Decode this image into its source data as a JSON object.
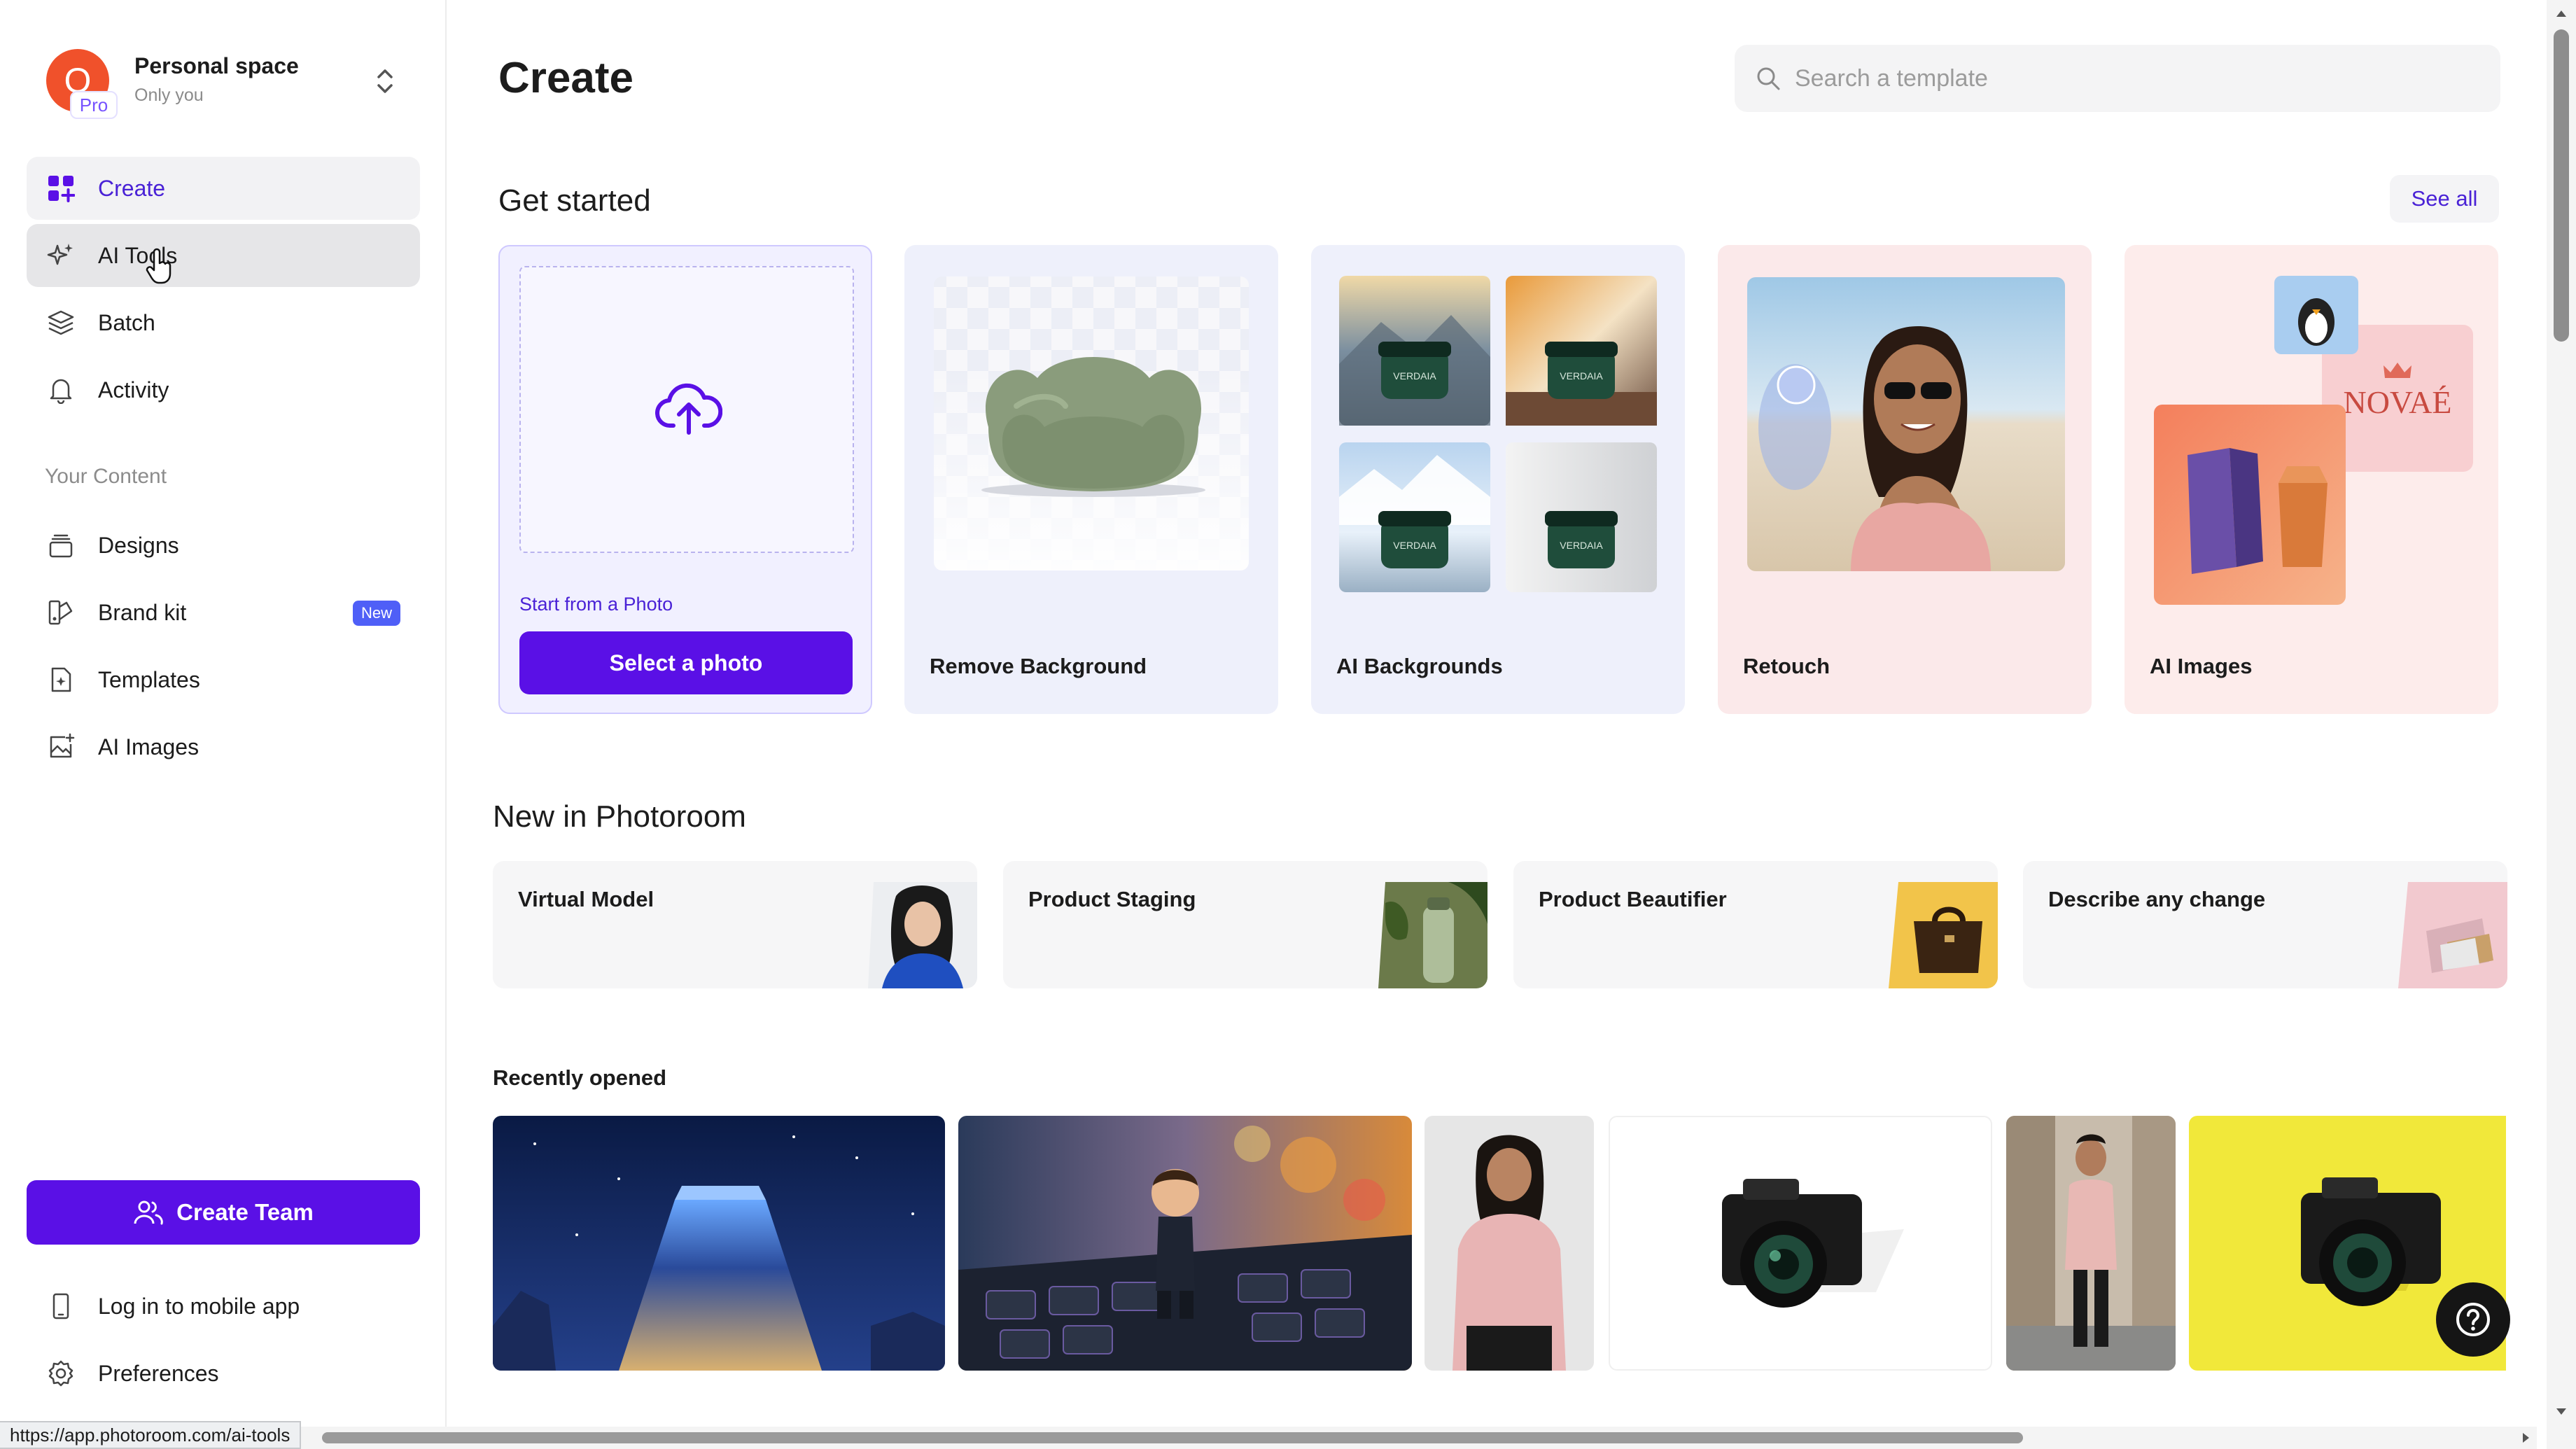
{
  "workspace": {
    "avatar_letter": "O",
    "badge": "Pro",
    "name": "Personal space",
    "subtitle": "Only you"
  },
  "nav": {
    "items": [
      {
        "label": "Create",
        "icon": "grid-icon"
      },
      {
        "label": "AI Tools",
        "icon": "sparkles-icon"
      },
      {
        "label": "Batch",
        "icon": "layers-icon"
      },
      {
        "label": "Activity",
        "icon": "bell-icon"
      }
    ],
    "section_label": "Your Content",
    "content_items": [
      {
        "label": "Designs",
        "icon": "stack-icon"
      },
      {
        "label": "Brand kit",
        "icon": "brand-icon",
        "badge": "New"
      },
      {
        "label": "Templates",
        "icon": "template-icon"
      },
      {
        "label": "AI Images",
        "icon": "image-plus-icon"
      }
    ],
    "create_team": "Create Team",
    "footer": [
      {
        "label": "Log in to mobile app",
        "icon": "phone-icon"
      },
      {
        "label": "Preferences",
        "icon": "gear-icon"
      }
    ]
  },
  "header": {
    "title": "Create",
    "search_placeholder": "Search a template"
  },
  "get_started": {
    "title": "Get started",
    "see_all": "See all",
    "upload": {
      "caption": "Start from a Photo",
      "button": "Select a photo"
    },
    "cards": [
      "Remove Background",
      "AI Backgrounds",
      "Retouch",
      "AI Images"
    ],
    "brand_text": "NOVAÉ",
    "jar_text": "VERDAIA"
  },
  "new_in": {
    "title": "New in Photoroom",
    "cards": [
      "Virtual Model",
      "Product Staging",
      "Product Beautifier",
      "Describe any change"
    ]
  },
  "recent": {
    "title": "Recently opened"
  },
  "status_url": "https://app.photoroom.com/ai-tools",
  "colors": {
    "accent": "#5a10e6",
    "avatar": "#f0512b",
    "new_badge": "#4f5ff7"
  }
}
